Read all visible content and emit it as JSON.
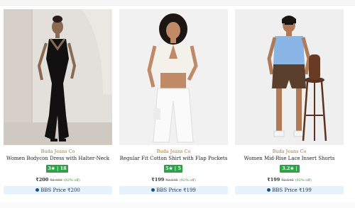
{
  "products": [
    {
      "brand": "Buda Jeans Co",
      "title": "Women Bodycon Dress with Halter-Neck",
      "rating": "3★ | 18",
      "price": "₹200",
      "mrp": "₹2,400",
      "discount": "(92% off)",
      "bbs_label": "BBS Price ₹200",
      "image_desc": "model-black-halter-dress"
    },
    {
      "brand": "Buda Jeans Co",
      "title": "Regular Fit Cotton Shirt with Flap Pockets",
      "rating": "5★ | 5",
      "price": "₹199",
      "mrp": "₹2,545",
      "discount": "(92% off)",
      "bbs_label": "BBS Price ₹199",
      "image_desc": "model-white-crop-top-jeans"
    },
    {
      "brand": "Buda Jeans Co",
      "title": "Women Mid-Rise Lace Insert Shorts",
      "rating": "3.2★ | 5",
      "price": "₹199",
      "mrp": "₹2,545",
      "discount": "(92% off)",
      "bbs_label": "BBS Price ₹199",
      "image_desc": "model-blue-shirt-brown-shorts"
    }
  ],
  "colors": {
    "brand_text": "#a8782a",
    "rating_bg": "#2fa24a",
    "bbs_bg": "#e6f2fc",
    "bbs_dot": "#1b4f8a"
  }
}
